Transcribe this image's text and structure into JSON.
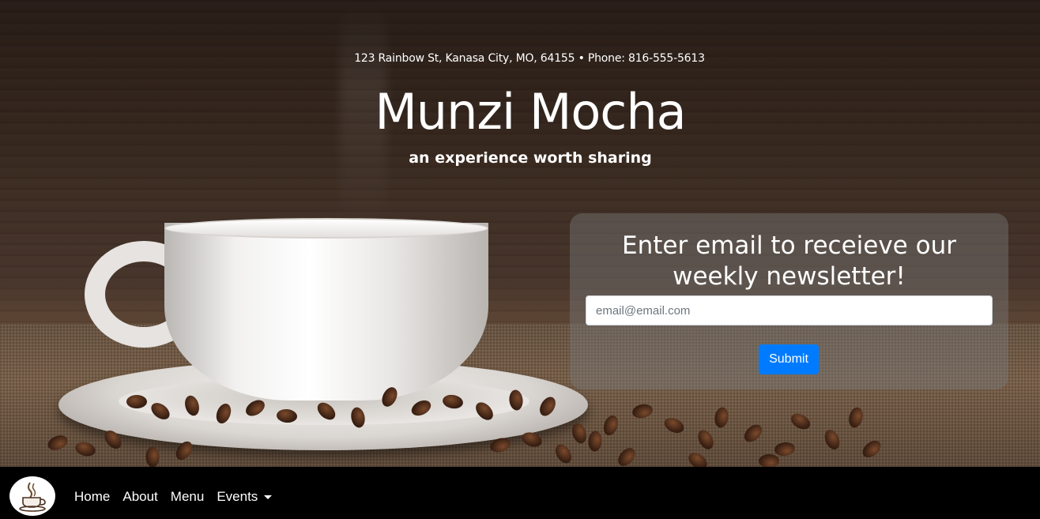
{
  "header": {
    "address": "123 Rainbow St, Kanasa City, MO, 64155 • Phone: 816-555-5613",
    "title": "Munzi Mocha",
    "tagline": "an experience worth sharing"
  },
  "newsletter": {
    "heading": "Enter email to receieve our weekly newsletter!",
    "email_placeholder": "email@email.com",
    "submit_label": "Submit"
  },
  "nav": {
    "logo_icon": "coffee-cup-icon",
    "items": [
      {
        "label": "Home"
      },
      {
        "label": "About"
      },
      {
        "label": "Menu"
      },
      {
        "label": "Events",
        "dropdown": true
      }
    ]
  },
  "colors": {
    "accent": "#007bff",
    "navbar": "#000000",
    "text": "#ffffff"
  }
}
